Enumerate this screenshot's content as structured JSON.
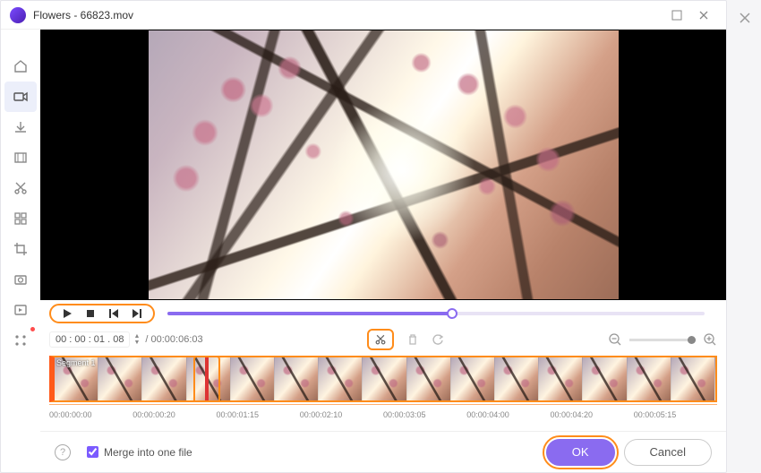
{
  "outer": {
    "close": "×"
  },
  "titlebar": {
    "title": "Flowers - 66823.mov"
  },
  "sidebar": {
    "items": [
      {
        "name": "home",
        "active": false
      },
      {
        "name": "video",
        "active": true
      },
      {
        "name": "download",
        "active": false
      },
      {
        "name": "frame",
        "active": false
      },
      {
        "name": "cut",
        "active": false
      },
      {
        "name": "grid",
        "active": false
      },
      {
        "name": "crop",
        "active": false
      },
      {
        "name": "capture",
        "active": false
      },
      {
        "name": "record",
        "active": false
      },
      {
        "name": "apps",
        "active": false
      }
    ]
  },
  "playback": {
    "progress_percent": 53,
    "current_time": "00 : 00 : 01 . 08",
    "total_time": "/ 00:00:06:03"
  },
  "zoom": {
    "minus": "−",
    "plus": "+"
  },
  "timeline": {
    "segment_label": "Segment 1",
    "thumbnail_count": 15,
    "ticks": [
      "00:00:00:00",
      "00:00:00:20",
      "00:00:01:15",
      "00:00:02:10",
      "00:00:03:05",
      "00:00:04:00",
      "00:00:04:20",
      "00:00:05:15"
    ]
  },
  "footer": {
    "merge_label": "Merge into one file",
    "merge_checked": true,
    "ok": "OK",
    "cancel": "Cancel",
    "help": "?"
  }
}
